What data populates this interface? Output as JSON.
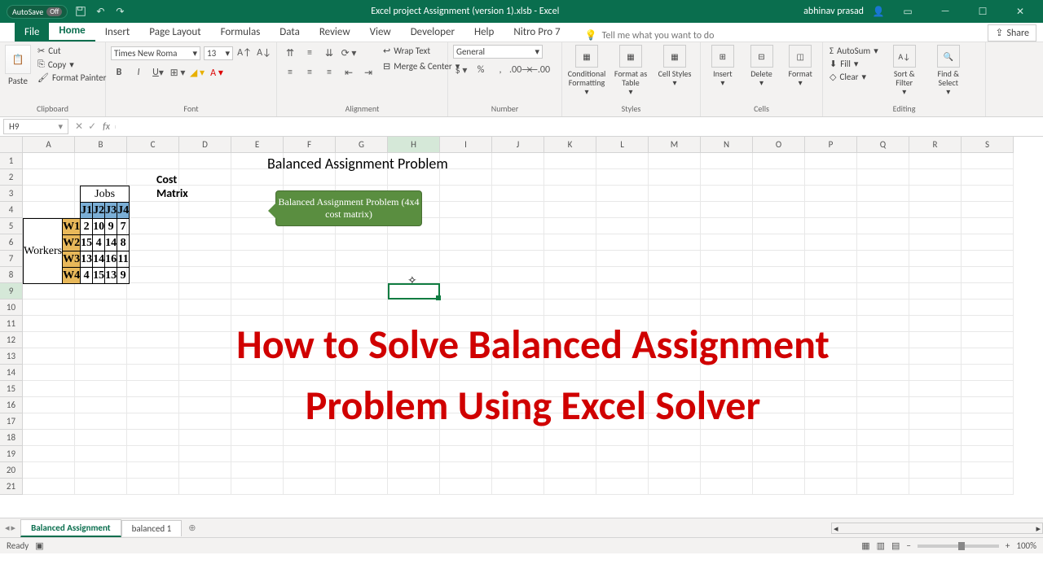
{
  "titlebar": {
    "autosave": "AutoSave",
    "autosave_state": "Off",
    "title": "Excel project Assignment (version 1).xlsb - Excel",
    "user": "abhinav prasad"
  },
  "menu": {
    "file": "File",
    "home": "Home",
    "insert": "Insert",
    "page_layout": "Page Layout",
    "formulas": "Formulas",
    "data": "Data",
    "review": "Review",
    "view": "View",
    "developer": "Developer",
    "help": "Help",
    "nitro": "Nitro Pro 7",
    "tell_me": "Tell me what you want to do",
    "share": "Share"
  },
  "ribbon": {
    "clipboard": {
      "label": "Clipboard",
      "paste": "Paste",
      "cut": "Cut",
      "copy": "Copy",
      "format_painter": "Format Painter"
    },
    "font": {
      "label": "Font",
      "name": "Times New Roma",
      "size": "13"
    },
    "alignment": {
      "label": "Alignment",
      "wrap": "Wrap Text",
      "merge": "Merge & Center"
    },
    "number": {
      "label": "Number",
      "format": "General"
    },
    "styles": {
      "label": "Styles",
      "cf": "Conditional Formatting",
      "fat": "Format as Table",
      "cs": "Cell Styles"
    },
    "cells": {
      "label": "Cells",
      "insert": "Insert",
      "delete": "Delete",
      "format": "Format"
    },
    "editing": {
      "label": "Editing",
      "autosum": "AutoSum",
      "fill": "Fill",
      "clear": "Clear",
      "sort": "Sort & Filter",
      "find": "Find & Select"
    }
  },
  "namebox": {
    "ref": "H9",
    "formula": ""
  },
  "columns": [
    "A",
    "B",
    "C",
    "D",
    "E",
    "F",
    "G",
    "H",
    "I",
    "J",
    "K",
    "L",
    "M",
    "N",
    "O",
    "P",
    "Q",
    "R",
    "S"
  ],
  "rows": [
    "1",
    "2",
    "3",
    "4",
    "5",
    "6",
    "7",
    "8",
    "9",
    "10",
    "11",
    "12",
    "13",
    "14",
    "15",
    "16",
    "17",
    "18",
    "19",
    "20",
    "21"
  ],
  "selected_col": "H",
  "selected_row": "9",
  "sheet": {
    "title": "Balanced Assignment Problem",
    "cost_matrix_label": "Cost Matrix",
    "jobs_label": "Jobs",
    "workers_label": "Workers",
    "job_headers": [
      "J1",
      "J2",
      "J3",
      "J4"
    ],
    "worker_headers": [
      "W1",
      "W2",
      "W3",
      "W4"
    ],
    "data": [
      [
        "2",
        "10",
        "9",
        "7"
      ],
      [
        "15",
        "4",
        "14",
        "8"
      ],
      [
        "13",
        "14",
        "16",
        "11"
      ],
      [
        "4",
        "15",
        "13",
        "9"
      ]
    ],
    "callout": "Balanced Assignment Problem (4x4 cost matrix)"
  },
  "overlay": {
    "line1": "How to Solve Balanced Assignment",
    "line2": "Problem Using Excel Solver"
  },
  "tabs": {
    "t1": "Balanced Assignment",
    "t2": "balanced 1"
  },
  "status": {
    "ready": "Ready",
    "zoom": "100%"
  }
}
